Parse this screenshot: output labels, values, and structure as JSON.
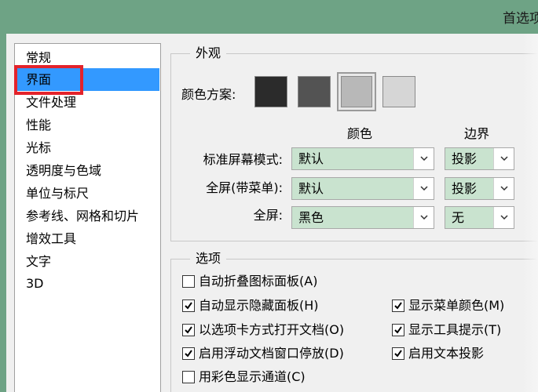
{
  "window": {
    "title": "首选项"
  },
  "sidebar": {
    "items": [
      {
        "label": "常规",
        "selected": false
      },
      {
        "label": "界面",
        "selected": true
      },
      {
        "label": "文件处理",
        "selected": false
      },
      {
        "label": "性能",
        "selected": false
      },
      {
        "label": "光标",
        "selected": false
      },
      {
        "label": "透明度与色域",
        "selected": false
      },
      {
        "label": "单位与标尺",
        "selected": false
      },
      {
        "label": "参考线、网格和切片",
        "selected": false
      },
      {
        "label": "增效工具",
        "selected": false
      },
      {
        "label": "文字",
        "selected": false
      },
      {
        "label": "3D",
        "selected": false
      }
    ]
  },
  "appearance": {
    "title": "外观",
    "color_scheme_label": "颜色方案:",
    "swatches": [
      {
        "name": "darkest",
        "color": "#2b2b2b",
        "selected": false
      },
      {
        "name": "dark",
        "color": "#535353",
        "selected": false
      },
      {
        "name": "medium",
        "color": "#b8b8b8",
        "selected": true
      },
      {
        "name": "light",
        "color": "#d6d6d6",
        "selected": false
      }
    ],
    "col_color": "颜色",
    "col_border": "边界",
    "rows": [
      {
        "label": "标准屏幕模式:",
        "color": "默认",
        "border": "投影"
      },
      {
        "label": "全屏(带菜单):",
        "color": "默认",
        "border": "投影"
      },
      {
        "label": "全屏:",
        "color": "黑色",
        "border": "无"
      }
    ]
  },
  "options": {
    "title": "选项",
    "left": [
      {
        "label": "自动折叠图标面板(A)",
        "checked": false
      },
      {
        "label": "自动显示隐藏面板(H)",
        "checked": true
      },
      {
        "label": "以选项卡方式打开文档(O)",
        "checked": true
      },
      {
        "label": "启用浮动文档窗口停放(D)",
        "checked": true
      },
      {
        "label": "用彩色显示通道(C)",
        "checked": false
      }
    ],
    "right": [
      {
        "label": "显示菜单颜色(M)",
        "checked": true
      },
      {
        "label": "显示工具提示(T)",
        "checked": true
      },
      {
        "label": "启用文本投影",
        "checked": true
      }
    ]
  },
  "colors": {
    "titlebar": "#6ea385",
    "selection": "#3399ff",
    "select_bg": "#c9e3cf",
    "highlight": "#e3232b"
  }
}
